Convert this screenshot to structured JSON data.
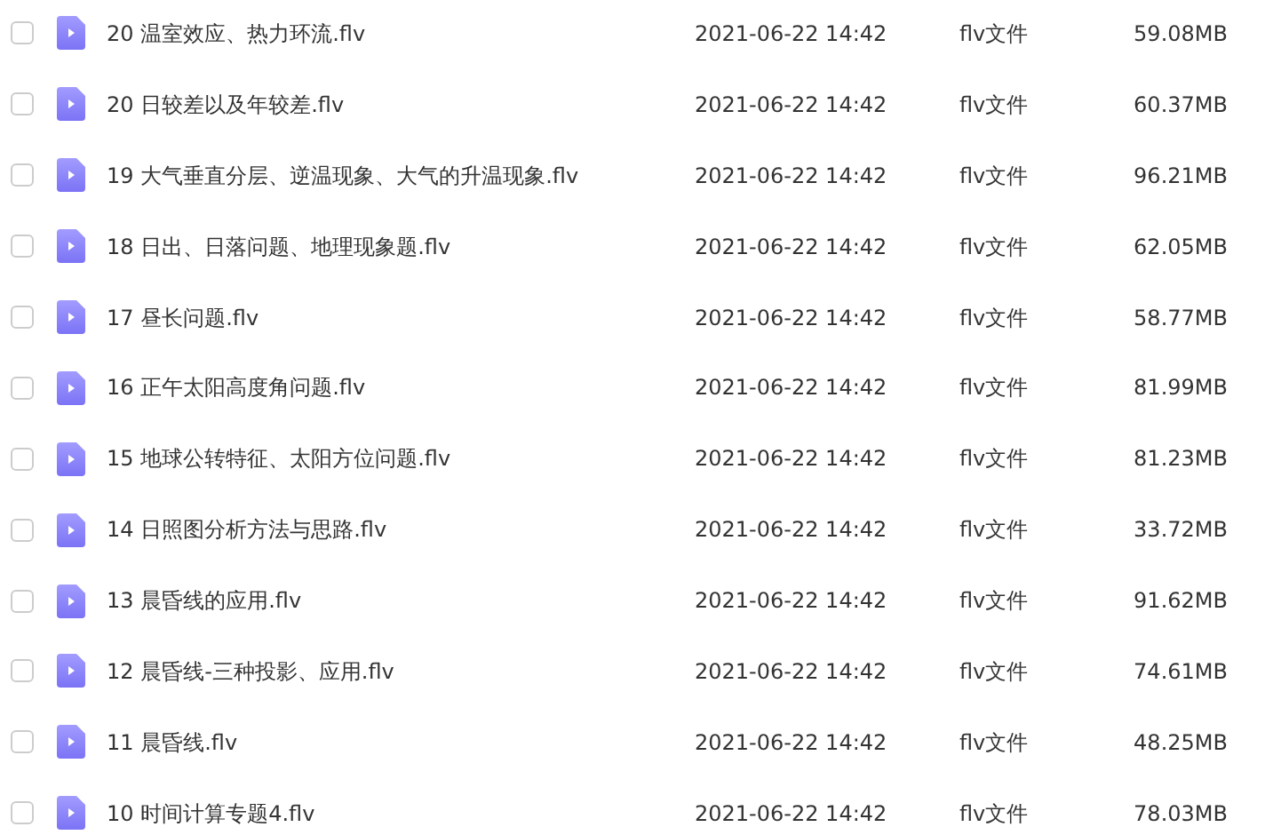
{
  "files": [
    {
      "checked": false,
      "name": "20 温室效应、热力环流.flv",
      "modified": "2021-06-22 14:42",
      "type": "flv文件",
      "size": "59.08MB"
    },
    {
      "checked": false,
      "name": "20 日较差以及年较差.flv",
      "modified": "2021-06-22 14:42",
      "type": "flv文件",
      "size": "60.37MB"
    },
    {
      "checked": false,
      "name": "19 大气垂直分层、逆温现象、大气的升温现象.flv",
      "modified": "2021-06-22 14:42",
      "type": "flv文件",
      "size": "96.21MB"
    },
    {
      "checked": false,
      "name": "18 日出、日落问题、地理现象题.flv",
      "modified": "2021-06-22 14:42",
      "type": "flv文件",
      "size": "62.05MB"
    },
    {
      "checked": false,
      "name": "17 昼长问题.flv",
      "modified": "2021-06-22 14:42",
      "type": "flv文件",
      "size": "58.77MB"
    },
    {
      "checked": false,
      "name": "16 正午太阳高度角问题.flv",
      "modified": "2021-06-22 14:42",
      "type": "flv文件",
      "size": "81.99MB"
    },
    {
      "checked": false,
      "name": "15 地球公转特征、太阳方位问题.flv",
      "modified": "2021-06-22 14:42",
      "type": "flv文件",
      "size": "81.23MB"
    },
    {
      "checked": false,
      "name": "14 日照图分析方法与思路.flv",
      "modified": "2021-06-22 14:42",
      "type": "flv文件",
      "size": "33.72MB"
    },
    {
      "checked": false,
      "name": "13 晨昏线的应用.flv",
      "modified": "2021-06-22 14:42",
      "type": "flv文件",
      "size": "91.62MB"
    },
    {
      "checked": false,
      "name": "12 晨昏线-三种投影、应用.flv",
      "modified": "2021-06-22 14:42",
      "type": "flv文件",
      "size": "74.61MB"
    },
    {
      "checked": false,
      "name": "11 晨昏线.flv",
      "modified": "2021-06-22 14:42",
      "type": "flv文件",
      "size": "48.25MB"
    },
    {
      "checked": false,
      "name": "10 时间计算专题4.flv",
      "modified": "2021-06-22 14:42",
      "type": "flv文件",
      "size": "78.03MB"
    }
  ]
}
